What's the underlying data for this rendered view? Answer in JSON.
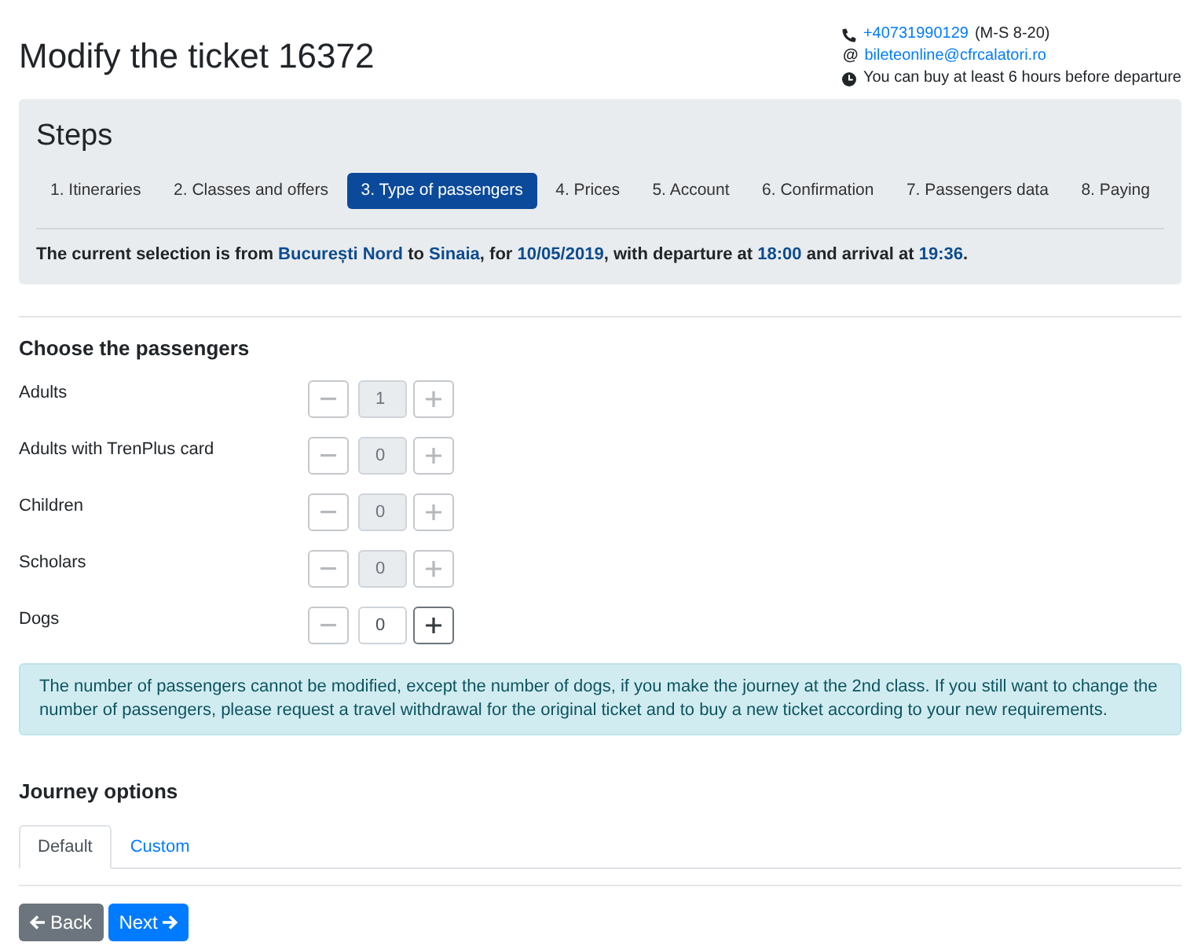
{
  "page": {
    "title": "Modify the ticket 16372"
  },
  "contact": [
    {
      "kind": "phone",
      "link": "+40731990129",
      "note": "(M-S 8-20)"
    },
    {
      "kind": "email",
      "symbol": "@",
      "link": "bileteonline@cfrcalatori.ro"
    },
    {
      "kind": "hours",
      "note": "You can buy at least 6 hours before departure"
    }
  ],
  "steps": {
    "title": "Steps",
    "items": [
      {
        "label": "1. Itineraries",
        "selected": false
      },
      {
        "label": "2. Classes and offers",
        "selected": false
      },
      {
        "label": "3. Type of passengers",
        "selected": true
      },
      {
        "label": "4. Prices",
        "selected": false
      },
      {
        "label": "5. Account",
        "selected": false
      },
      {
        "label": "6. Confirmation",
        "selected": false
      },
      {
        "label": "7. Passengers data",
        "selected": false
      },
      {
        "label": "8. Paying",
        "selected": false
      }
    ],
    "selection": [
      {
        "text": "The current selection is from ",
        "highlight": false
      },
      {
        "text": "București Nord",
        "highlight": true
      },
      {
        "text": " to ",
        "highlight": false
      },
      {
        "text": "Sinaia",
        "highlight": true
      },
      {
        "text": ", for ",
        "highlight": false
      },
      {
        "text": "10/05/2019",
        "highlight": true
      },
      {
        "text": ", with departure at ",
        "highlight": false
      },
      {
        "text": "18:00",
        "highlight": true
      },
      {
        "text": " and arrival at ",
        "highlight": false
      },
      {
        "text": "19:36",
        "highlight": true
      },
      {
        "text": ".",
        "highlight": false
      }
    ]
  },
  "passengers": {
    "title": "Choose the passengers",
    "rows": [
      {
        "label": "Adults",
        "value": "1",
        "disabled": true,
        "minus_disabled": true,
        "plus_disabled": true
      },
      {
        "label": "Adults with TrenPlus card",
        "value": "0",
        "disabled": true,
        "minus_disabled": true,
        "plus_disabled": true
      },
      {
        "label": "Children",
        "value": "0",
        "disabled": true,
        "minus_disabled": true,
        "plus_disabled": true
      },
      {
        "label": "Scholars",
        "value": "0",
        "disabled": true,
        "minus_disabled": true,
        "plus_disabled": true
      },
      {
        "label": "Dogs",
        "value": "0",
        "disabled": false,
        "minus_disabled": true,
        "plus_disabled": false
      }
    ]
  },
  "notice": "The number of passengers cannot be modified, except the number of dogs, if you make the journey at the 2nd class. If you still want to change the number of passengers, please request a travel withdrawal for the original ticket and to buy a new ticket according to your new requirements.",
  "journey_options": {
    "title": "Journey options",
    "tabs": [
      {
        "label": "Default",
        "selected": true
      },
      {
        "label": "Custom",
        "selected": false
      }
    ]
  },
  "buttons": [
    {
      "kind": "back",
      "label": "Back"
    },
    {
      "kind": "next",
      "label": "Next"
    }
  ]
}
